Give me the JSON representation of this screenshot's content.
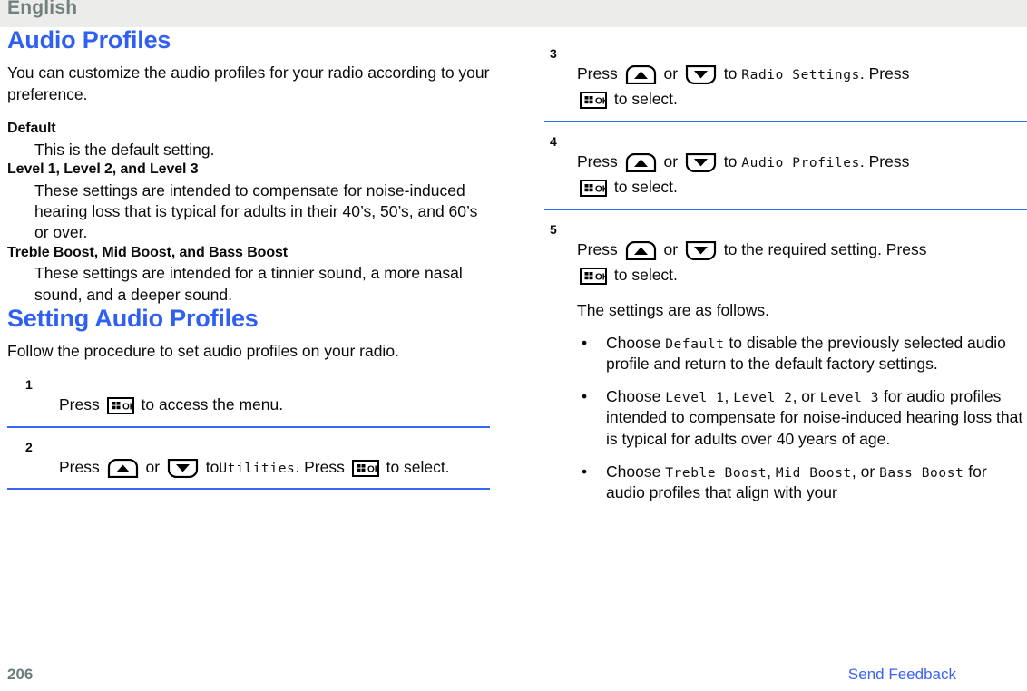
{
  "header": {
    "language": "English",
    "band_color": "#ececeb",
    "text_color": "#72807f"
  },
  "theme": {
    "heading_blue": "#2f60f2",
    "rule_blue": "#3568f4",
    "link_blue": "#3b63f0",
    "page_number_gray": "#6d7b7c",
    "body_black": "#0a0a0a"
  },
  "left_column": {
    "title": "Audio Profiles",
    "intro": "You can customize the audio profiles for your radio according to your preference.",
    "definitions": [
      {
        "term": "Default",
        "description": "This is the default setting."
      },
      {
        "term": "Level 1, Level 2, and Level 3",
        "description": "These settings are intended to compensate for noise-induced hearing loss that is typical for adults in their 40’s, 50’s, and 60’s or over."
      },
      {
        "term": "Treble Boost, Mid Boost, and Bass Boost",
        "description": "These settings are intended for a tinnier sound, a more nasal sound, and a deeper sound."
      }
    ],
    "subsection_title": "Setting Audio Profiles",
    "subsection_intro": "Follow the procedure to set audio profiles on your radio.",
    "steps": [
      {
        "number": "1",
        "text_before": "Press",
        "keys": [
          "ok-key"
        ],
        "text_after": "to access the menu."
      },
      {
        "number": "2",
        "prefix": "Press",
        "key_up": "up-arrow-key",
        "conjunction": "or",
        "key_down": "down-arrow-key",
        "to_label": "to",
        "menu_item": "Utilities",
        "press_label": ". Press",
        "ok_key": "ok-key",
        "suffix": "to select."
      }
    ]
  },
  "right_column": {
    "steps": [
      {
        "number": "3",
        "prefix": "Press",
        "key_up": "up-arrow-key",
        "conjunction": "or",
        "key_down": "down-arrow-key",
        "to_label": "to",
        "menu_item": "Radio Settings",
        "press_label": ". Press",
        "ok_key": "ok-key",
        "suffix": "to select."
      },
      {
        "number": "4",
        "prefix": "Press",
        "key_up": "up-arrow-key",
        "conjunction": "or",
        "key_down": "down-arrow-key",
        "to_label": "to",
        "menu_item": "Audio Profiles",
        "press_label": ". Press",
        "ok_key": "ok-key",
        "suffix": "to select."
      },
      {
        "number": "5",
        "prefix": "Press",
        "key_up": "up-arrow-key",
        "conjunction": "or",
        "key_down": "down-arrow-key",
        "to_label": "to the required setting. Press",
        "ok_key": "ok-key",
        "suffix": "to select.",
        "note": "The settings are as follows.",
        "bullets": [
          {
            "lead": "Choose",
            "mono_1": "Default",
            "tail": "to disable the previously selected audio profile and return to the default factory settings."
          },
          {
            "lead": "Choose",
            "mono_1": "Level 1",
            "sep_1": ",",
            "mono_2": "Level 2",
            "sep_2": ", or",
            "mono_3": "Level 3",
            "tail": "for audio profiles intended to compensate for noise-induced hearing loss that is typical for adults over 40 years of age."
          },
          {
            "lead": "Choose",
            "mono_1": "Treble Boost",
            "sep_1": ",",
            "mono_2": "Mid Boost",
            "sep_2": ", or",
            "mono_3": "Bass Boost",
            "tail": "for audio profiles that align with your"
          }
        ]
      }
    ]
  },
  "footer": {
    "page_number": "206",
    "send_feedback": "Send Feedback"
  }
}
